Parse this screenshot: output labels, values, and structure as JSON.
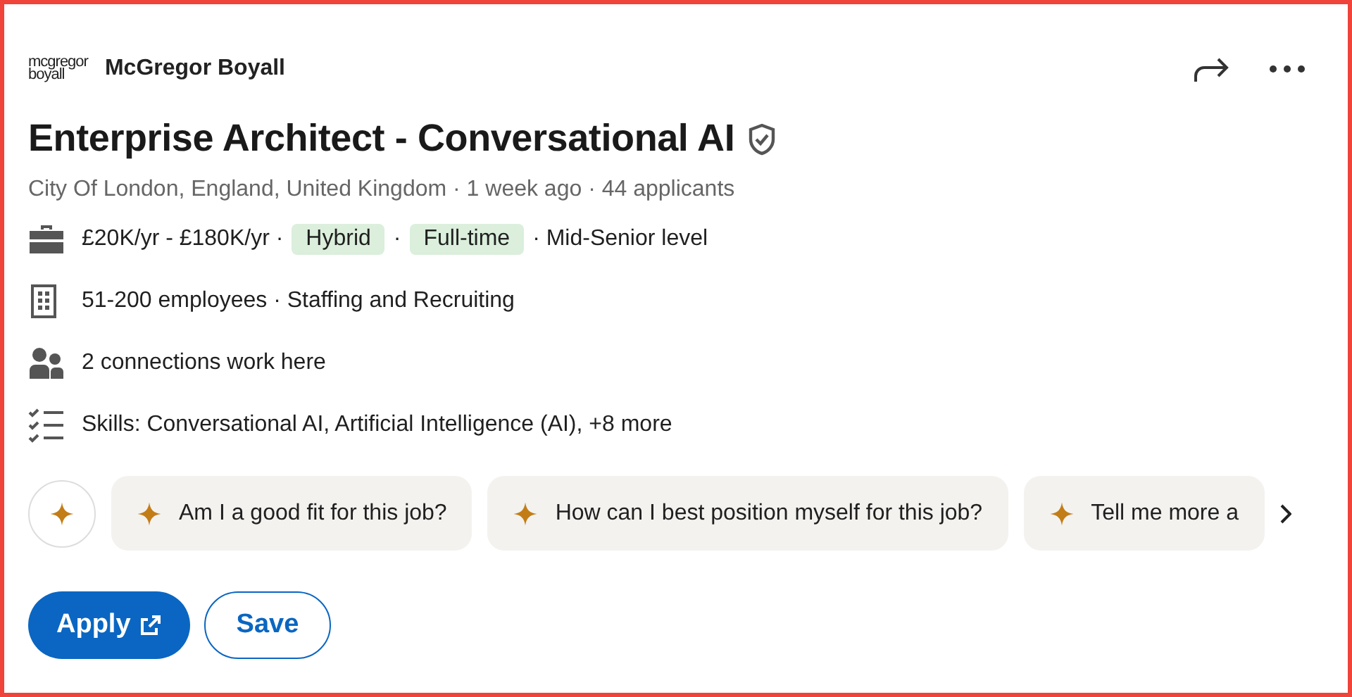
{
  "company": {
    "logo_lines": [
      "mcgregor",
      "boyall"
    ],
    "name": "McGregor Boyall"
  },
  "job": {
    "title": "Enterprise Architect - Conversational AI",
    "verified": true,
    "meta": "City Of London, England, United Kingdom · 1 week ago · 44 applicants"
  },
  "details": [
    {
      "kind": "pay",
      "parts": [
        {
          "text": "£20K/yr - £180K/yr ·",
          "tag": false
        },
        {
          "text": "Hybrid",
          "tag": true
        },
        {
          "text": "·",
          "tag": false
        },
        {
          "text": "Full-time",
          "tag": true
        },
        {
          "text": "· Mid-Senior level",
          "tag": false
        }
      ]
    },
    {
      "kind": "company",
      "parts": [
        {
          "text": "51-200 employees · Staffing and Recruiting",
          "tag": false
        }
      ]
    },
    {
      "kind": "people",
      "parts": [
        {
          "text": "2 connections work here",
          "tag": false
        }
      ]
    },
    {
      "kind": "skills",
      "parts": [
        {
          "text": "Skills: Conversational AI, Artificial Intelligence (AI), +8 more",
          "tag": false
        }
      ]
    }
  ],
  "prompts": [
    "Am I a good fit for this job?",
    "How can I best position myself for this job?",
    "Tell me more a"
  ],
  "buttons": [
    {
      "label": "Apply",
      "kind": "primary",
      "external": true
    },
    {
      "label": "Save",
      "kind": "secondary",
      "external": false
    }
  ]
}
